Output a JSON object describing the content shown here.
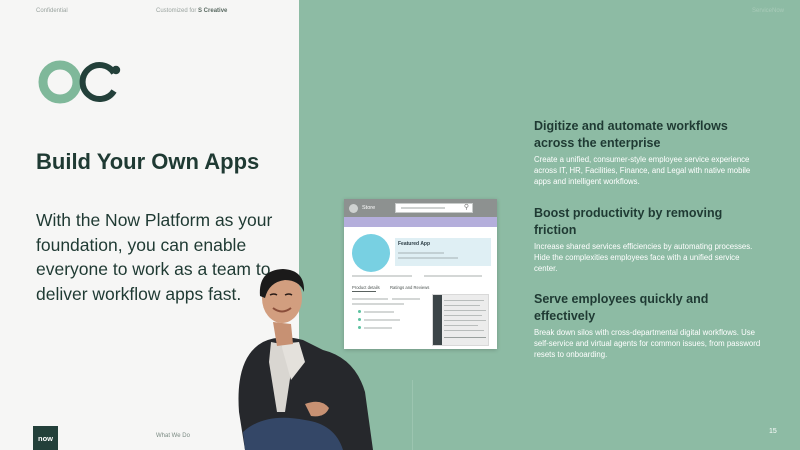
{
  "header": {
    "confidential": "Confidential",
    "customized_prefix": "Customized for ",
    "customized_client": "S Creative",
    "right_label": "ServiceNow"
  },
  "hero": {
    "title": "Build Your Own Apps",
    "subtitle": "With the Now Platform as your foundation, you can enable everyone to work as a team to deliver workflow apps fast."
  },
  "store_mockup": {
    "bar_title": "Store",
    "featured_label": "Featured App",
    "tab_details": "Product details",
    "tab_reviews": "Ratings and Reviews"
  },
  "features": [
    {
      "heading": "Digitize and automate workflows across the enterprise",
      "body": "Create a unified, consumer-style employee service experience across IT, HR, Facilities, Finance, and Legal with native mobile apps and intelligent workflows."
    },
    {
      "heading": "Boost productivity by removing friction",
      "body": "Increase shared services efficiencies by automating processes. Hide the complexities employees face with a unified service center."
    },
    {
      "heading": "Serve employees quickly and effectively",
      "body": "Break down silos with cross-departmental digital workflows. Use self-service and virtual agents for common issues, from password resets to onboarding."
    }
  ],
  "footer": {
    "badge": "now",
    "section": "What We Do",
    "page_number": "15"
  },
  "colors": {
    "panel_green": "#8dbba4",
    "text_dark": "#1f3a33",
    "logo_teal": "#7fb89a",
    "logo_dark": "#23403a"
  },
  "icons": [
    "servicenow-logo-icon",
    "search-icon"
  ]
}
